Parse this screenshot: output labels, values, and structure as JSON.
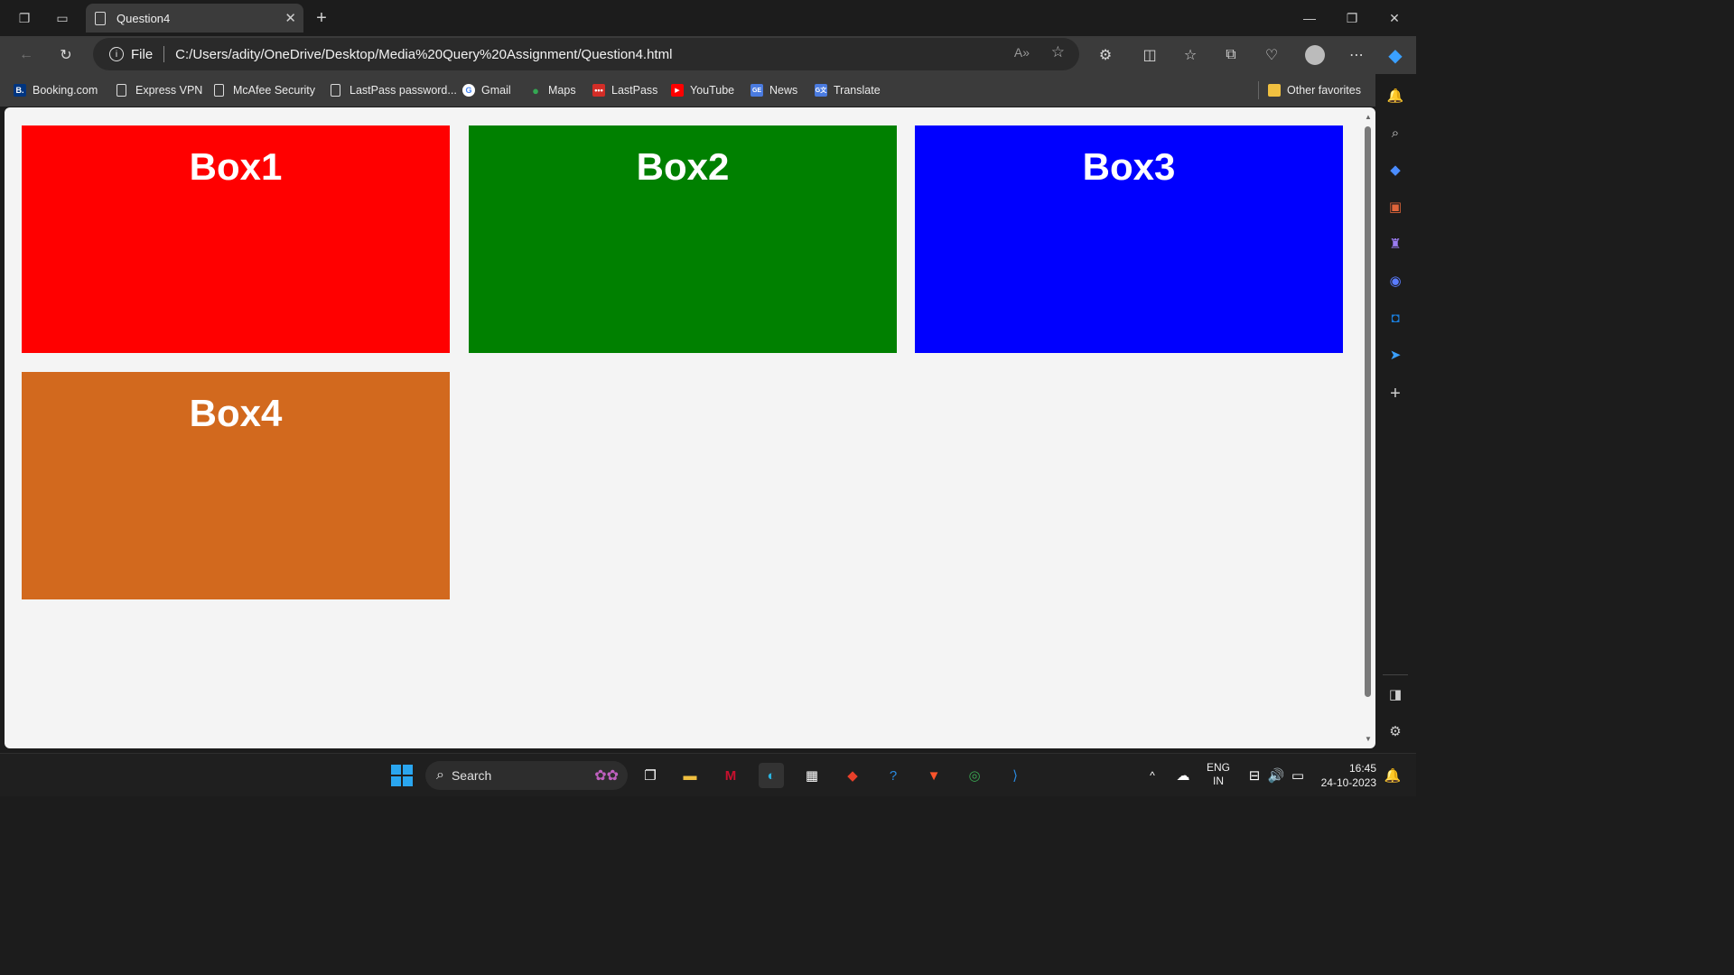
{
  "browser": {
    "tab_title": "Question4",
    "address_scheme": "File",
    "address_url": "C:/Users/adity/OneDrive/Desktop/Media%20Query%20Assignment/Question4.html"
  },
  "bookmarks": [
    {
      "label": "Booking.com",
      "icon": "booking-icon",
      "color": "#003580"
    },
    {
      "label": "Express VPN",
      "icon": "page-icon"
    },
    {
      "label": "McAfee Security",
      "icon": "page-icon"
    },
    {
      "label": "LastPass password...",
      "icon": "page-icon"
    },
    {
      "label": "Gmail",
      "icon": "google-icon"
    },
    {
      "label": "Maps",
      "icon": "maps-icon"
    },
    {
      "label": "LastPass",
      "icon": "lastpass-icon",
      "color": "#d32d27"
    },
    {
      "label": "YouTube",
      "icon": "youtube-icon",
      "color": "#ff0000"
    },
    {
      "label": "News",
      "icon": "news-icon",
      "color": "#4a7be0"
    },
    {
      "label": "Translate",
      "icon": "translate-icon",
      "color": "#4a7be0"
    }
  ],
  "other_favorites": "Other favorites",
  "page": {
    "boxes": [
      {
        "label": "Box1",
        "color": "#ff0000"
      },
      {
        "label": "Box2",
        "color": "#008000"
      },
      {
        "label": "Box3",
        "color": "#0000ff"
      },
      {
        "label": "Box4",
        "color": "#d2691e"
      }
    ],
    "background": "#f4f4f4"
  },
  "taskbar": {
    "search_placeholder": "Search",
    "lang_top": "ENG",
    "lang_bottom": "IN",
    "time": "16:45",
    "date": "24-10-2023"
  }
}
